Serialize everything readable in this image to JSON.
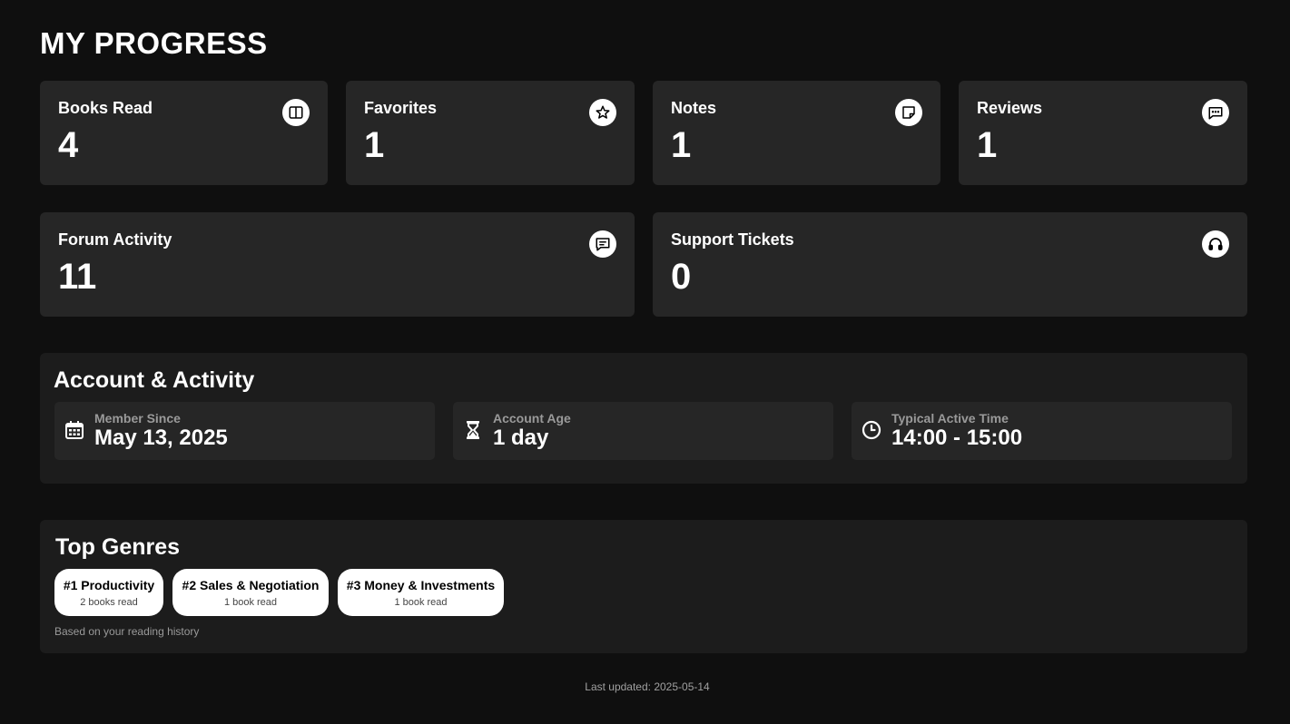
{
  "page": {
    "title": "MY PROGRESS"
  },
  "stats": [
    {
      "label": "Books Read",
      "value": "4",
      "icon": "book-open-icon"
    },
    {
      "label": "Favorites",
      "value": "1",
      "icon": "star-icon"
    },
    {
      "label": "Notes",
      "value": "1",
      "icon": "note-icon"
    },
    {
      "label": "Reviews",
      "value": "1",
      "icon": "review-chat-icon"
    },
    {
      "label": "Forum Activity",
      "value": "11",
      "icon": "forum-chat-icon"
    },
    {
      "label": "Support Tickets",
      "value": "0",
      "icon": "headset-icon"
    }
  ],
  "account": {
    "title": "Account & Activity",
    "items": [
      {
        "label": "Member Since",
        "value": "May 13, 2025",
        "icon": "calendar-icon"
      },
      {
        "label": "Account Age",
        "value": "1 day",
        "icon": "hourglass-icon"
      },
      {
        "label": "Typical Active Time",
        "value": "14:00 - 15:00",
        "icon": "clock-icon"
      }
    ]
  },
  "genres": {
    "title": "Top Genres",
    "items": [
      {
        "name": "#1 Productivity",
        "count": "2 books read"
      },
      {
        "name": "#2 Sales & Negotiation",
        "count": "1 book read"
      },
      {
        "name": "#3 Money & Investments",
        "count": "1 book read"
      }
    ],
    "note": "Based on your reading history"
  },
  "footer": {
    "last_updated": "Last updated: 2025-05-14"
  },
  "colors": {
    "background": "#0f0f0f",
    "card": "#262626",
    "panel": "#1c1c1c",
    "text": "#ffffff",
    "muted": "#9a9a9a"
  }
}
